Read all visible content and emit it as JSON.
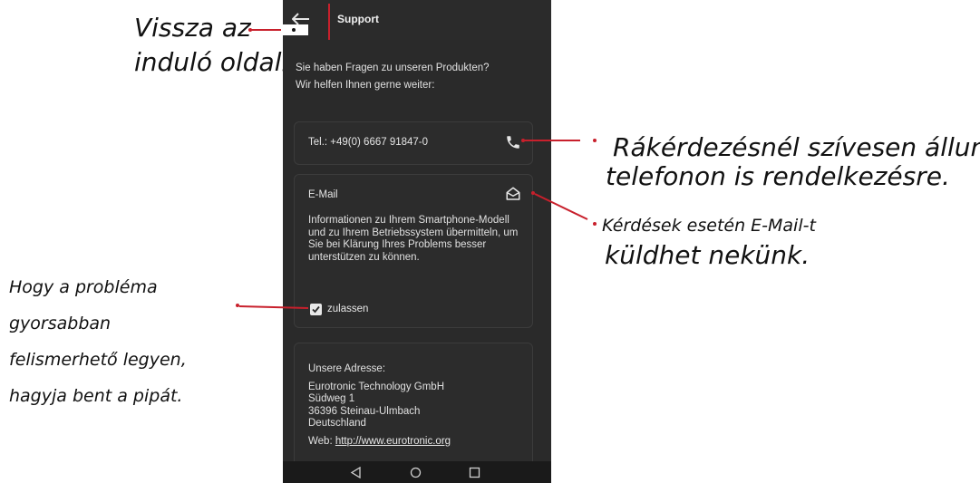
{
  "annotations": {
    "back_line1": "Vissza az",
    "back_line2": "induló oldalra",
    "phone_line1": "Rákérdezésnél szívesen állunk",
    "phone_line2": "telefonon is rendelkezésre.",
    "mail_line1": "Kérdések esetén E-Mail-t",
    "mail_line2": "küldhet nekünk.",
    "check_line1": "Hogy a probléma",
    "check_line2": "gyorsabban",
    "check_line3": "felismerhető legyen,",
    "check_line4": "hagyja bent a pipát.",
    "line_color": "#c8202c"
  },
  "appbar": {
    "title": "Support",
    "back_icon": "arrow-left-icon"
  },
  "intro": {
    "line1": "Sie haben Fragen zu unseren Produkten?",
    "line2": "Wir helfen Ihnen gerne weiter:"
  },
  "phone_card": {
    "text": "Tel.: +49(0) 6667 91847-0",
    "icon": "phone-icon"
  },
  "email_card": {
    "title": "E-Mail",
    "icon": "envelope-open-icon",
    "description": "Informationen zu Ihrem Smartphone-Modell und zu Ihrem Betriebssystem übermitteln, um Sie bei Klärung Ihres Problems besser unterstützen zu können.",
    "consent_label": "zulassen",
    "consent_checked": true
  },
  "address_card": {
    "heading": "Unsere Adresse:",
    "company": "Eurotronic Technology GmbH",
    "street": "Südweg 1",
    "city": "36396 Steinau-Ulmbach",
    "country": "Deutschland",
    "web_label": "Web:",
    "web_url": "http://www.eurotronic.org"
  },
  "navbar": {
    "back": "nav-back-icon",
    "home": "nav-home-icon",
    "recent": "nav-recent-icon"
  },
  "colors": {
    "screen_bg": "#2a2a2a",
    "accent": "#c8202c",
    "text": "#e6e6e6"
  }
}
